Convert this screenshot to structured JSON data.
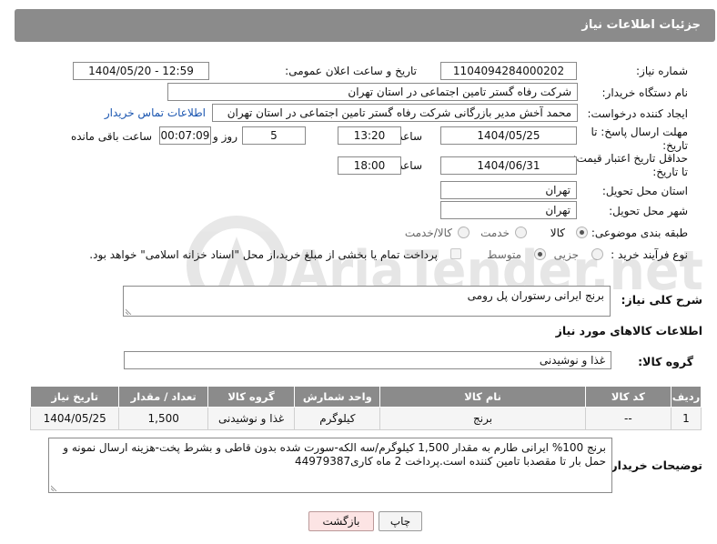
{
  "header": {
    "title": "جزئیات اطلاعات نیاز"
  },
  "form": {
    "need_number_label": "شماره نیاز:",
    "need_number": "1104094284000202",
    "announce_label": "تاریخ و ساعت اعلان عمومی:",
    "announce_value": "1404/05/20 - 12:59",
    "buyer_label": "نام دستگاه خریدار:",
    "buyer_value": "شرکت رفاه گستر تامین اجتماعی در استان تهران",
    "creator_label": "ایجاد کننده درخواست:",
    "creator_value": "محمد آخش مدیر بازرگانی شرکت رفاه گستر تامین اجتماعی در استان تهران",
    "contact_link": "اطلاعات تماس خریدار",
    "deadline_label_1": "مهلت ارسال پاسخ: تا",
    "deadline_label_2": "تاریخ:",
    "deadline_date": "1404/05/25",
    "time_label": "ساعت",
    "deadline_time": "13:20",
    "days_value": "5",
    "days_label": "روز و",
    "remaining_value": "00:07:09",
    "remaining_label": "ساعت باقی مانده",
    "validity_label_1": "حداقل تاریخ اعتبار قیمت:",
    "validity_label_2": "تا تاریخ:",
    "validity_date": "1404/06/31",
    "validity_time": "18:00",
    "province_label": "استان محل تحویل:",
    "province_value": "تهران",
    "city_label": "شهر محل تحویل:",
    "city_value": "تهران",
    "category_label": "طبقه بندی موضوعی:",
    "category_options": [
      "کالا",
      "خدمت",
      "کالا/خدمت"
    ],
    "process_label": "نوع فرآیند خرید :",
    "process_options": [
      "جزیی",
      "متوسط"
    ],
    "payment_note": "پرداخت تمام یا بخشی از مبلغ خرید،از محل \"اسناد خزانه اسلامی\" خواهد بود."
  },
  "description": {
    "label": "شرح کلی نیاز:",
    "value": "برنج ایرانی رستوران پل رومی"
  },
  "goods": {
    "section_title": "اطلاعات کالاهای مورد نیاز",
    "group_label": "گروه کالا:",
    "group_value": "غذا و نوشیدنی",
    "columns": [
      "ردیف",
      "کد کالا",
      "نام کالا",
      "واحد شمارش",
      "گروه کالا",
      "تعداد / مقدار",
      "تاریخ نیاز"
    ],
    "rows": [
      [
        "1",
        "--",
        "برنج",
        "کیلوگرم",
        "غذا و نوشیدنی",
        "1,500",
        "1404/05/25"
      ]
    ]
  },
  "buyer_notes": {
    "label": "توضیحات خریدار:",
    "value": "برنج 100% ایرانی طارم به مقدار 1,500 کیلوگرم/سه الکه-سورت شده بدون قاطی و بشرط پخت-هزینه ارسال نمونه و حمل بار تا مقصدبا تامین کننده است.پرداخت 2 ماه کاری44979387"
  },
  "buttons": {
    "print": "چاپ",
    "back": "بازگشت"
  },
  "watermark": {
    "text": "AriaTender.net"
  },
  "colors": {
    "header_bg": "#8b8b8b",
    "link": "#1a55b0",
    "back_btn": "#fce4e4"
  }
}
